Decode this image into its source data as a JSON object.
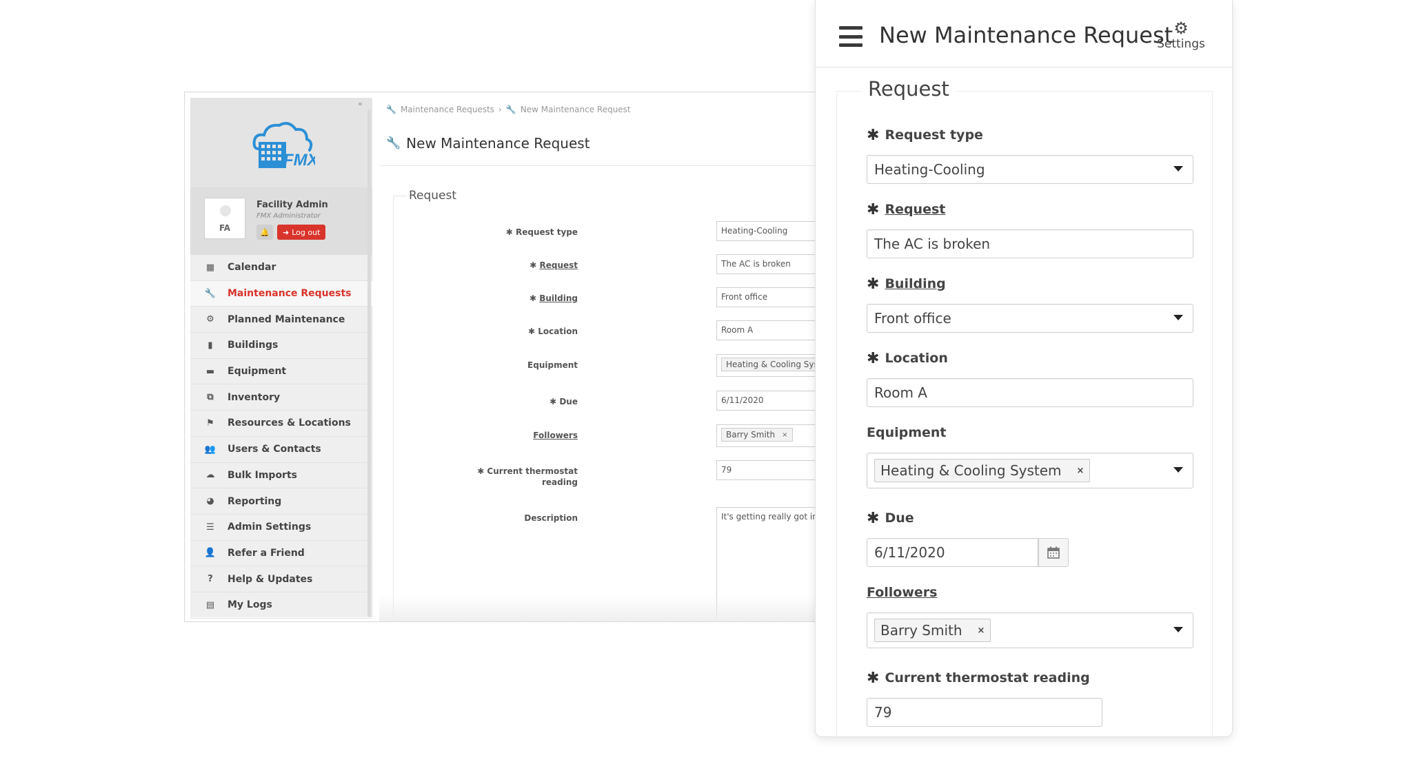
{
  "desktop": {
    "logo_text": "FMX",
    "profile": {
      "initials": "FA",
      "name": "Facility Admin",
      "role": "FMX Administrator",
      "logout_label": "Log out"
    },
    "nav": [
      {
        "label": "Calendar",
        "icon": "calendar-icon",
        "glyph": "▦"
      },
      {
        "label": "Maintenance Requests",
        "icon": "wrench-icon",
        "glyph": "🔧",
        "active": true
      },
      {
        "label": "Planned Maintenance",
        "icon": "gears-icon",
        "glyph": "⚙"
      },
      {
        "label": "Buildings",
        "icon": "building-icon",
        "glyph": "▮"
      },
      {
        "label": "Equipment",
        "icon": "briefcase-icon",
        "glyph": "▬"
      },
      {
        "label": "Inventory",
        "icon": "cubes-icon",
        "glyph": "⧉"
      },
      {
        "label": "Resources & Locations",
        "icon": "flag-icon",
        "glyph": "⚑"
      },
      {
        "label": "Users & Contacts",
        "icon": "users-icon",
        "glyph": "👥"
      },
      {
        "label": "Bulk Imports",
        "icon": "cloud-upload-icon",
        "glyph": "☁"
      },
      {
        "label": "Reporting",
        "icon": "pie-chart-icon",
        "glyph": "◕"
      },
      {
        "label": "Admin Settings",
        "icon": "sliders-icon",
        "glyph": "☰"
      },
      {
        "label": "Refer a Friend",
        "icon": "user-plus-icon",
        "glyph": "👤"
      },
      {
        "label": "Help & Updates",
        "icon": "question-icon",
        "glyph": "?"
      },
      {
        "label": "My Logs",
        "icon": "book-icon",
        "glyph": "▤"
      }
    ],
    "breadcrumb": [
      "Maintenance Requests",
      "New Maintenance Request"
    ],
    "page_title": "New Maintenance Request",
    "section": "Request",
    "fields": {
      "request_type": {
        "label": "Request type",
        "value": "Heating-Cooling"
      },
      "request": {
        "label": "Request",
        "value": "The AC is broken"
      },
      "building": {
        "label": "Building",
        "value": "Front office"
      },
      "location": {
        "label": "Location",
        "value": "Room A"
      },
      "equipment": {
        "label": "Equipment",
        "value": "Heating & Cooling System"
      },
      "due": {
        "label": "Due",
        "value": "6/11/2020"
      },
      "followers": {
        "label": "Followers",
        "value": "Barry Smith"
      },
      "thermostat": {
        "label_line1": "Current thermostat",
        "label_line2": "reading",
        "value": "79"
      },
      "description": {
        "label": "Description",
        "value": "It's getting really got in here!"
      }
    }
  },
  "mobile": {
    "title": "New Maintenance Request",
    "settings_label": "Settings",
    "section": "Request",
    "fields": {
      "request_type": {
        "label": "Request type",
        "value": "Heating-Cooling"
      },
      "request": {
        "label": "Request",
        "value": "The AC is broken"
      },
      "building": {
        "label": "Building",
        "value": "Front office"
      },
      "location": {
        "label": "Location",
        "value": "Room A"
      },
      "equipment": {
        "label": "Equipment",
        "value": "Heating & Cooling System"
      },
      "due": {
        "label": "Due",
        "value": "6/11/2020"
      },
      "followers": {
        "label": "Followers",
        "value": "Barry Smith"
      },
      "thermostat": {
        "label": "Current thermostat reading",
        "value": "79"
      }
    }
  },
  "colors": {
    "accent_red": "#d9342b",
    "logo_blue": "#2b8fd6",
    "sidebar_bg": "#efefef"
  }
}
